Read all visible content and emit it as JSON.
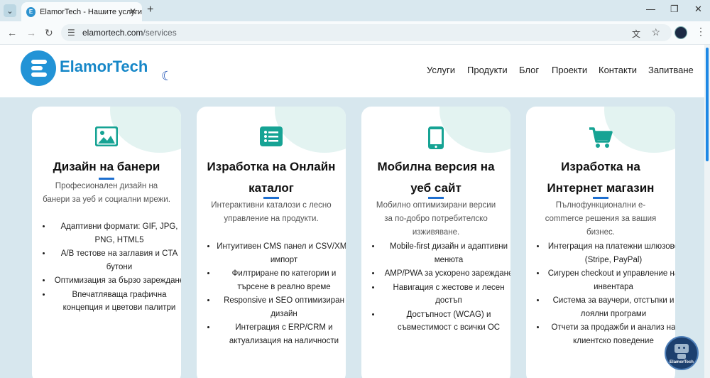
{
  "browser": {
    "tab_title": "ElamorTech - Нашите услуги",
    "url_host": "elamortech.com",
    "url_path": "/services"
  },
  "site": {
    "logo_text": "ElamorTech",
    "nav": [
      "Услуги",
      "Продукти",
      "Блог",
      "Проекти",
      "Контакти",
      "Запитване"
    ],
    "chatbot_label": "ElamorTech"
  },
  "cards": [
    {
      "icon": "image-icon",
      "title": "Дизайн на банери",
      "desc": "Професионален дизайн на банери за уеб и социални мрежи.",
      "features": [
        "Адаптивни формати: GIF, JPG, PNG, HTML5",
        "A/B тестове на заглавия и CTA бутони",
        "Оптимизация за бързо зареждане",
        "Впечатляваща графична концепция и цветови палитри"
      ]
    },
    {
      "icon": "list-icon",
      "title": "Изработка на Онлайн каталог",
      "desc": "Интерактивни каталози с лесно управление на продукти.",
      "features": [
        "Интуитивен CMS панел и CSV/XML импорт",
        "Филтриране по категории и търсене в реално време",
        "Responsive и SEO оптимизиран дизайн",
        "Интеграция с ERP/CRM и актуализация на наличности"
      ]
    },
    {
      "icon": "mobile-icon",
      "title": "Мобилна версия на уеб сайт",
      "desc": "Мобилно оптимизирани версии за по-добро потребителско изживяване.",
      "features": [
        "Mobile-first дизайн и адаптивни менюта",
        "AMP/PWA за ускорено зареждане",
        "Навигация с жестове и лесен достъп",
        "Достъпност (WCAG) и съвместимост с всички ОС"
      ]
    },
    {
      "icon": "cart-icon",
      "title": "Изработка на Интернет магазин",
      "desc": "Пълнофункционални e-commerce решения за вашия бизнес.",
      "features": [
        "Интеграция на платежни шлюзове (Stripe, PayPal)",
        "Сигурен checkout и управление на инвентара",
        "Система за ваучери, отстъпки и лоялни програми",
        "Отчети за продажби и анализ на клиентско поведение"
      ]
    }
  ],
  "colors": {
    "accent": "#16a394",
    "brand": "#1687c8",
    "underline": "#1e6fd0",
    "page_bg": "#d7e7ee"
  }
}
